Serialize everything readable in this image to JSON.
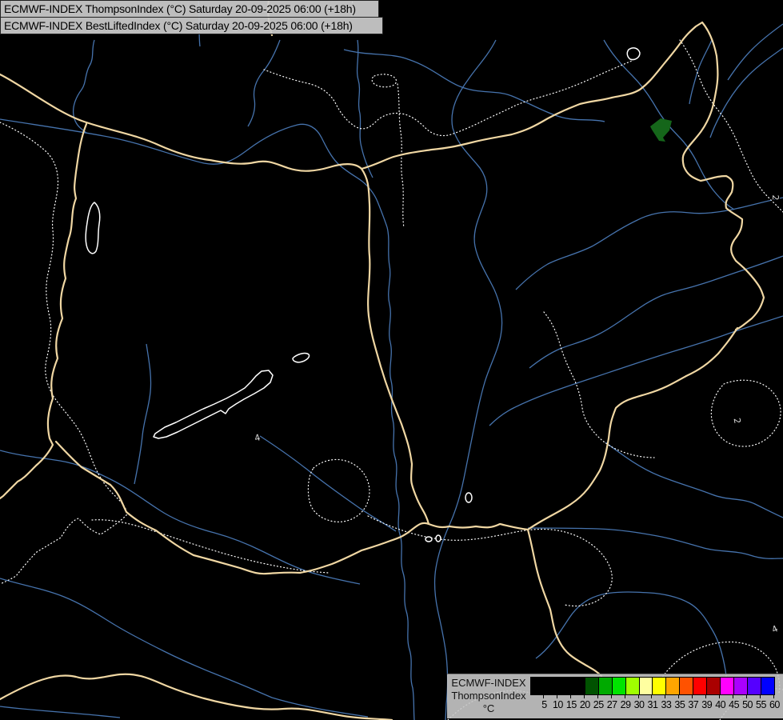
{
  "header": {
    "line1": "ECMWF-INDEX ThompsonIndex (°C) Saturday 20-09-2025 06:00 (+18h)",
    "line2": "ECMWF-INDEX BestLiftedIndex (°C) Saturday 20-09-2025 06:00 (+18h)"
  },
  "map": {
    "labels": [
      {
        "text": "4"
      },
      {
        "text": "2"
      },
      {
        "text": "2"
      },
      {
        "text": "4"
      }
    ],
    "colors": {
      "background": "#000000",
      "country_border": "#f0d7a3",
      "river": "#4673ad",
      "contour_dotted": "#ffffff",
      "lake_outline": "#ffffff",
      "index_patch_green": "#15661a"
    }
  },
  "legend": {
    "title_lines": [
      "ECMWF-INDEX",
      "ThompsonIndex",
      "°C"
    ],
    "tick_labels": [
      "5",
      "10",
      "15",
      "20",
      "25",
      "27",
      "29",
      "30",
      "31",
      "33",
      "35",
      "37",
      "39",
      "40",
      "45",
      "50",
      "55",
      "60"
    ],
    "segment_colors": [
      "#000000",
      "#000000",
      "#000000",
      "#000000",
      "#005200",
      "#00aa00",
      "#00e400",
      "#a0ff00",
      "#ffffa0",
      "#ffff00",
      "#ffa500",
      "#ff5200",
      "#ff0000",
      "#aa0000",
      "#ff00ff",
      "#aa00ff",
      "#5500ff",
      "#0000ff"
    ]
  }
}
